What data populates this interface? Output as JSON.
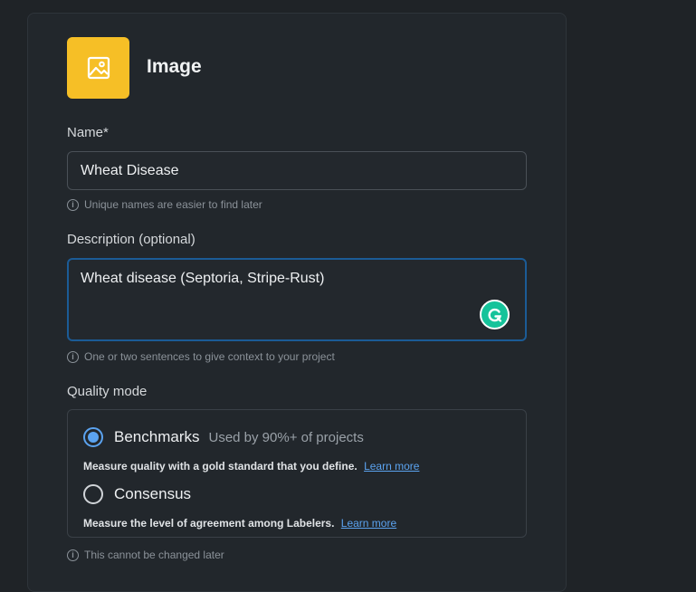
{
  "header": {
    "title": "Image",
    "icon": "image-icon",
    "icon_color": "#f6bf26"
  },
  "name_field": {
    "label": "Name*",
    "value": "Wheat Disease",
    "hint": "Unique names are easier to find later"
  },
  "description_field": {
    "label": "Description (optional)",
    "value": "Wheat disease (Septoria, Stripe-Rust)",
    "hint": "One or two sentences to give context to your project"
  },
  "quality_mode": {
    "label": "Quality mode",
    "options": [
      {
        "title": "Benchmarks",
        "subtitle": "Used by 90%+ of projects",
        "description": "Measure quality with a gold standard that you define.",
        "link": "Learn more",
        "selected": true
      },
      {
        "title": "Consensus",
        "description": "Measure the level of agreement among Labelers.",
        "link": "Learn more",
        "selected": false
      }
    ],
    "hint": "This cannot be changed later"
  },
  "colors": {
    "accent": "#5ba3f0",
    "grammarly": "#15c39a",
    "focus_border": "#1b5b96"
  }
}
